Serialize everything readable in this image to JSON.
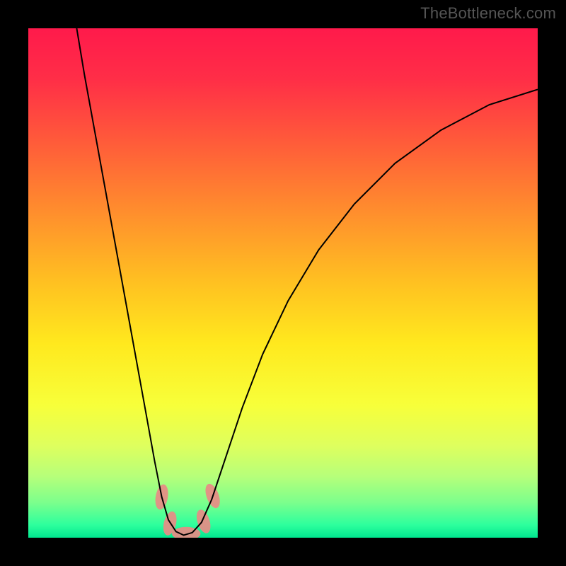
{
  "watermark": "TheBottleneck.com",
  "chart_data": {
    "type": "line",
    "title": "",
    "xlabel": "",
    "ylabel": "",
    "xlim": [
      0,
      1
    ],
    "ylim": [
      0,
      1
    ],
    "axes_visible": false,
    "legend": false,
    "gradient_stops": [
      {
        "offset": 0.0,
        "color": "#ff1a4b"
      },
      {
        "offset": 0.1,
        "color": "#ff2e47"
      },
      {
        "offset": 0.22,
        "color": "#ff5a3a"
      },
      {
        "offset": 0.35,
        "color": "#ff8a2e"
      },
      {
        "offset": 0.5,
        "color": "#ffc121"
      },
      {
        "offset": 0.62,
        "color": "#ffe91e"
      },
      {
        "offset": 0.74,
        "color": "#f7ff3a"
      },
      {
        "offset": 0.82,
        "color": "#deff5e"
      },
      {
        "offset": 0.88,
        "color": "#b6ff7a"
      },
      {
        "offset": 0.93,
        "color": "#7dff8c"
      },
      {
        "offset": 0.975,
        "color": "#2dff9d"
      },
      {
        "offset": 1.0,
        "color": "#00e78f"
      }
    ],
    "series": [
      {
        "name": "bottleneck-curve",
        "stroke": "#000000",
        "stroke_width": 2,
        "data": [
          {
            "x": 0.095,
            "y": 1.0
          },
          {
            "x": 0.11,
            "y": 0.91
          },
          {
            "x": 0.13,
            "y": 0.8
          },
          {
            "x": 0.15,
            "y": 0.69
          },
          {
            "x": 0.17,
            "y": 0.58
          },
          {
            "x": 0.19,
            "y": 0.47
          },
          {
            "x": 0.21,
            "y": 0.36
          },
          {
            "x": 0.23,
            "y": 0.25
          },
          {
            "x": 0.248,
            "y": 0.15
          },
          {
            "x": 0.262,
            "y": 0.08
          },
          {
            "x": 0.275,
            "y": 0.035
          },
          {
            "x": 0.29,
            "y": 0.012
          },
          {
            "x": 0.305,
            "y": 0.005
          },
          {
            "x": 0.322,
            "y": 0.01
          },
          {
            "x": 0.34,
            "y": 0.03
          },
          {
            "x": 0.36,
            "y": 0.075
          },
          {
            "x": 0.385,
            "y": 0.15
          },
          {
            "x": 0.42,
            "y": 0.255
          },
          {
            "x": 0.46,
            "y": 0.36
          },
          {
            "x": 0.51,
            "y": 0.465
          },
          {
            "x": 0.57,
            "y": 0.565
          },
          {
            "x": 0.64,
            "y": 0.655
          },
          {
            "x": 0.72,
            "y": 0.735
          },
          {
            "x": 0.81,
            "y": 0.8
          },
          {
            "x": 0.905,
            "y": 0.85
          },
          {
            "x": 1.0,
            "y": 0.88
          }
        ]
      }
    ],
    "markers": [
      {
        "name": "marker-left-upper",
        "color": "#e88b86",
        "x": 0.262,
        "y": 0.08,
        "rx": 0.012,
        "ry": 0.025,
        "rot": 10
      },
      {
        "name": "marker-left-lower",
        "color": "#e88b86",
        "x": 0.278,
        "y": 0.028,
        "rx": 0.012,
        "ry": 0.024,
        "rot": 14
      },
      {
        "name": "marker-bottom",
        "color": "#e88b86",
        "x": 0.31,
        "y": 0.008,
        "rx": 0.028,
        "ry": 0.013,
        "rot": 0
      },
      {
        "name": "marker-right-lower",
        "color": "#e88b86",
        "x": 0.344,
        "y": 0.032,
        "rx": 0.012,
        "ry": 0.024,
        "rot": -18
      },
      {
        "name": "marker-right-upper",
        "color": "#e88b86",
        "x": 0.362,
        "y": 0.082,
        "rx": 0.012,
        "ry": 0.025,
        "rot": -20
      }
    ]
  }
}
